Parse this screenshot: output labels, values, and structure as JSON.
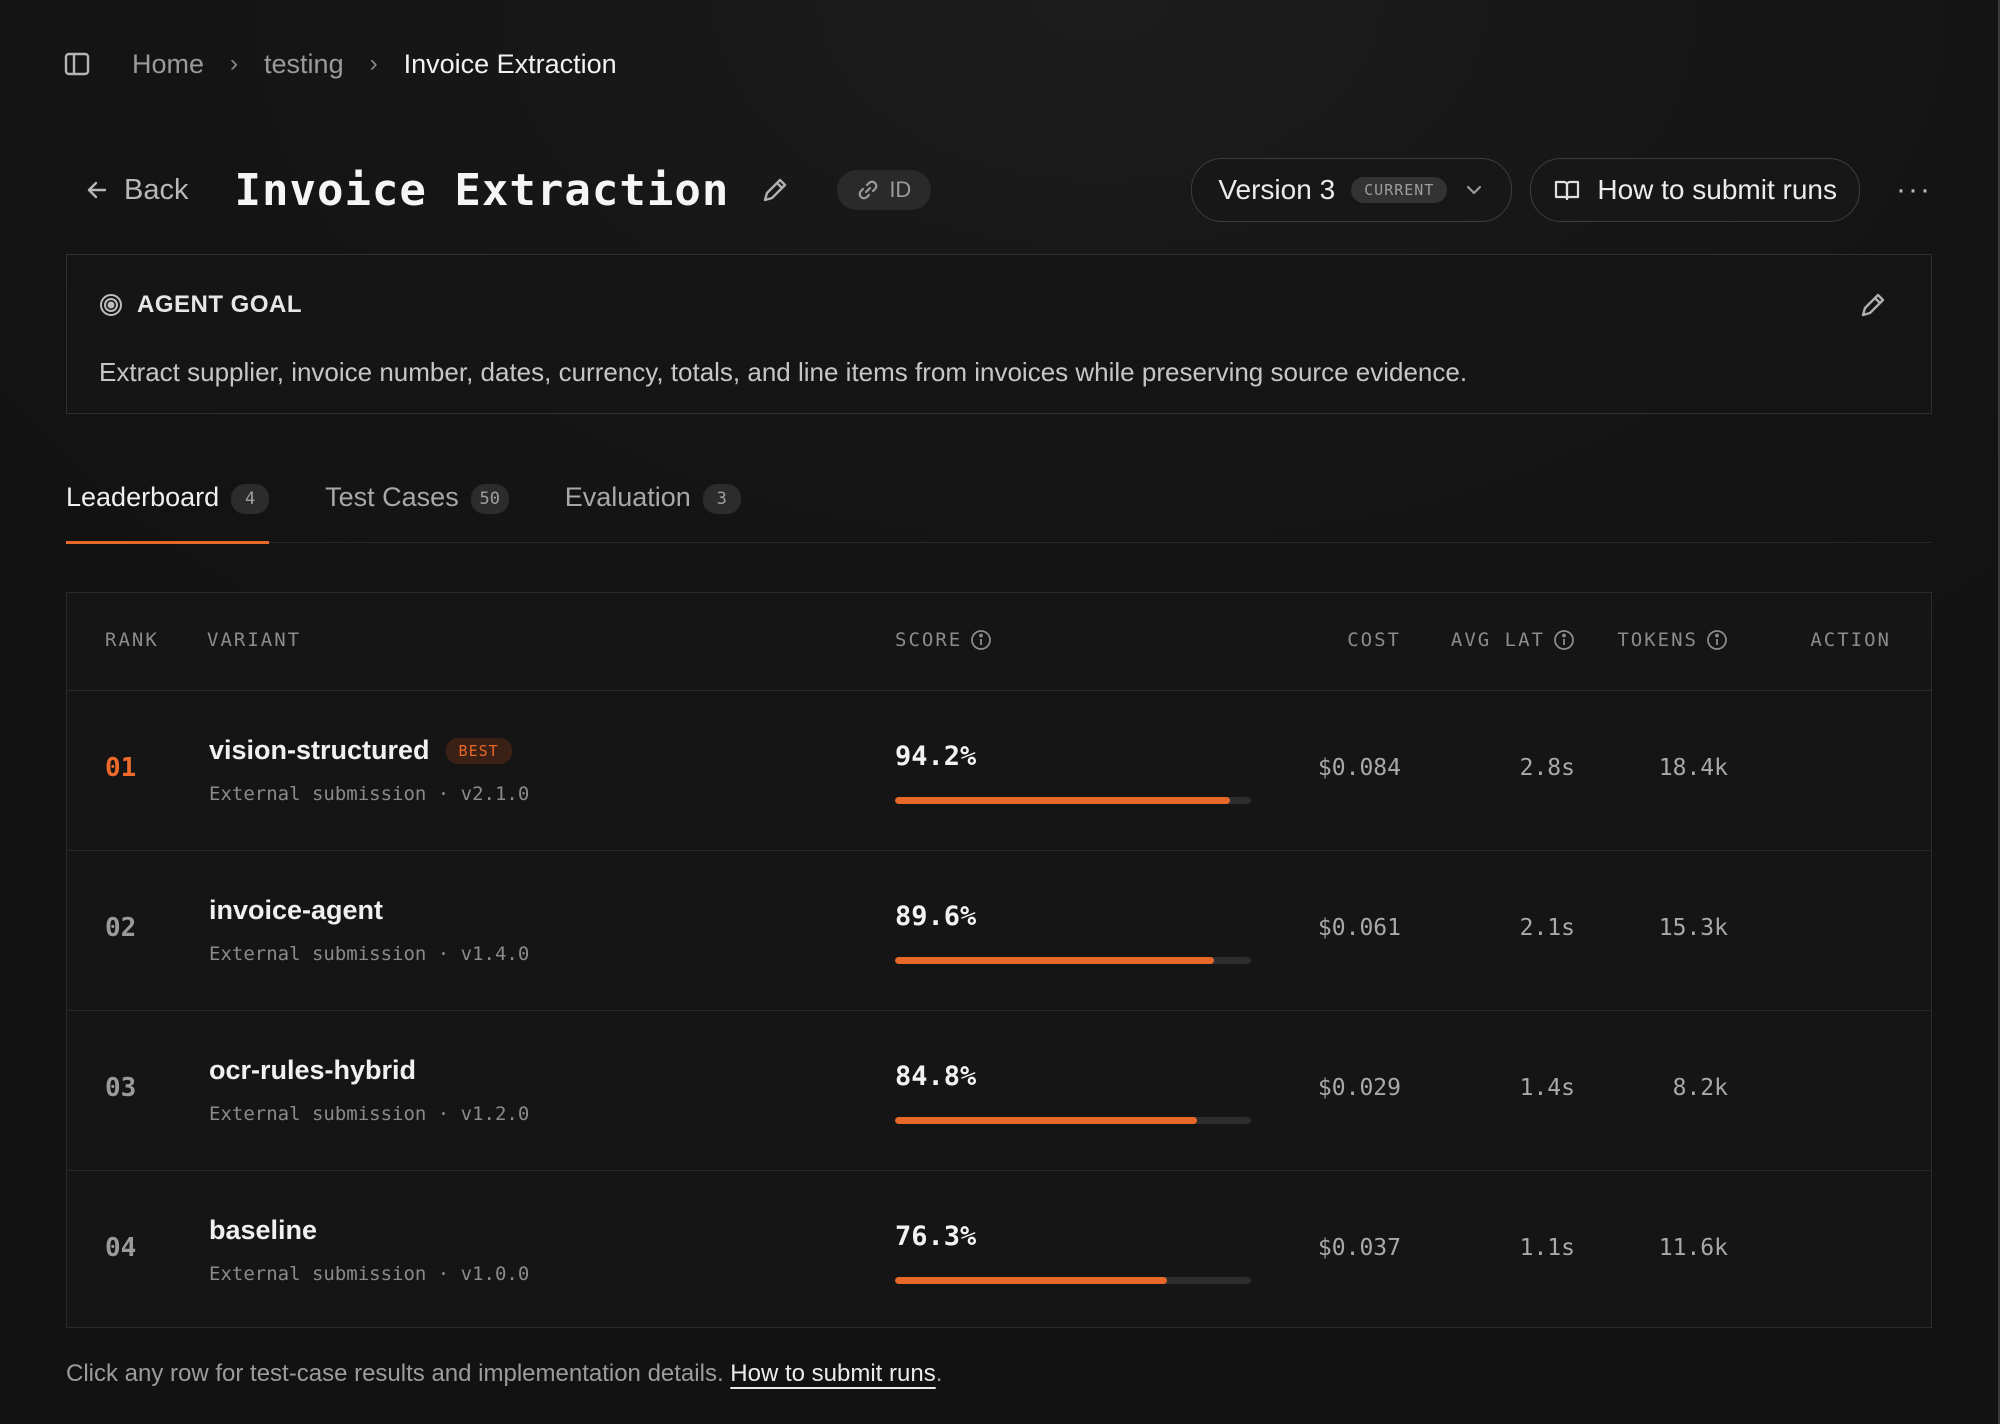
{
  "breadcrumb": {
    "items": [
      "Home",
      "testing",
      "Invoice Extraction"
    ]
  },
  "header": {
    "back_label": "Back",
    "title": "Invoice Extraction",
    "id_label": "ID",
    "version_label": "Version 3",
    "version_badge": "CURRENT",
    "howto_label": "How to submit runs",
    "more_label": "···"
  },
  "goal": {
    "heading": "AGENT GOAL",
    "text": "Extract supplier, invoice number, dates, currency, totals, and line items from invoices while preserving source evidence."
  },
  "tabs": [
    {
      "label": "Leaderboard",
      "count": "4"
    },
    {
      "label": "Test Cases",
      "count": "50"
    },
    {
      "label": "Evaluation",
      "count": "3"
    }
  ],
  "table": {
    "columns": {
      "rank": "RANK",
      "variant": "VARIANT",
      "score": "SCORE",
      "cost": "COST",
      "avg_lat": "AVG LAT",
      "tokens": "TOKENS",
      "action": "ACTION"
    },
    "best_badge": "BEST",
    "rows": [
      {
        "rank": "01",
        "name": "vision-structured",
        "sub": "External submission · v2.1.0",
        "score": "94.2%",
        "score_value": 94.2,
        "cost": "$0.084",
        "lat": "2.8s",
        "tokens": "18.4k"
      },
      {
        "rank": "02",
        "name": "invoice-agent",
        "sub": "External submission · v1.4.0",
        "score": "89.6%",
        "score_value": 89.6,
        "cost": "$0.061",
        "lat": "2.1s",
        "tokens": "15.3k"
      },
      {
        "rank": "03",
        "name": "ocr-rules-hybrid",
        "sub": "External submission · v1.2.0",
        "score": "84.8%",
        "score_value": 84.8,
        "cost": "$0.029",
        "lat": "1.4s",
        "tokens": "8.2k"
      },
      {
        "rank": "04",
        "name": "baseline",
        "sub": "External submission · v1.0.0",
        "score": "76.3%",
        "score_value": 76.3,
        "cost": "$0.037",
        "lat": "1.1s",
        "tokens": "11.6k"
      }
    ]
  },
  "footer": {
    "note": "Click any row for test-case results and implementation details.",
    "link": "How to submit runs",
    "period": "."
  },
  "colors": {
    "accent": "#e8682a",
    "background": "#141414"
  },
  "icons": {
    "sidebar": "sidebar-toggle-icon",
    "back": "arrow-left-icon",
    "edit": "pencil-icon",
    "link": "link-icon",
    "chevron": "chevron-down-icon",
    "book": "book-icon",
    "target": "target-icon",
    "info": "info-icon"
  }
}
